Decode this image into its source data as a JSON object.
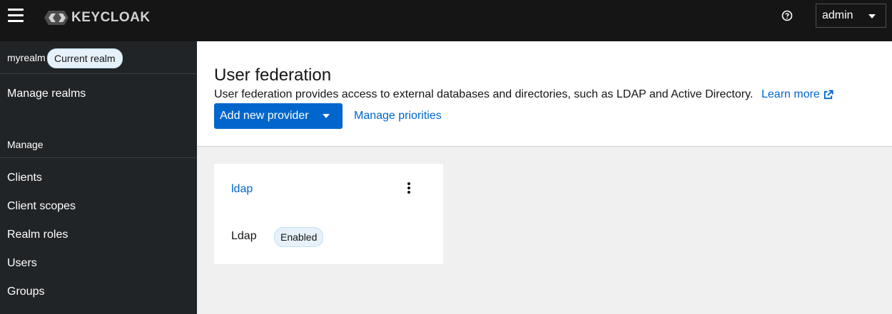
{
  "masthead": {
    "brand": "KEYCLOAK",
    "user": "admin"
  },
  "sidebar": {
    "realm_name": "myrealm",
    "realm_badge": "Current realm",
    "manage_realms": "Manage realms",
    "section_title": "Manage",
    "items": [
      {
        "label": "Clients"
      },
      {
        "label": "Client scopes"
      },
      {
        "label": "Realm roles"
      },
      {
        "label": "Users"
      },
      {
        "label": "Groups"
      }
    ]
  },
  "header": {
    "title": "User federation",
    "description": "User federation provides access to external databases and directories, such as LDAP and Active Directory.",
    "learn_more": "Learn more",
    "add_provider": "Add new provider",
    "manage_priorities": "Manage priorities"
  },
  "providers": [
    {
      "name": "ldap",
      "type": "Ldap",
      "status": "Enabled"
    }
  ],
  "colors": {
    "masthead": "#151515",
    "sidebar": "#212427",
    "primary": "#0066cc",
    "badge_bg": "#e7f1fa"
  }
}
